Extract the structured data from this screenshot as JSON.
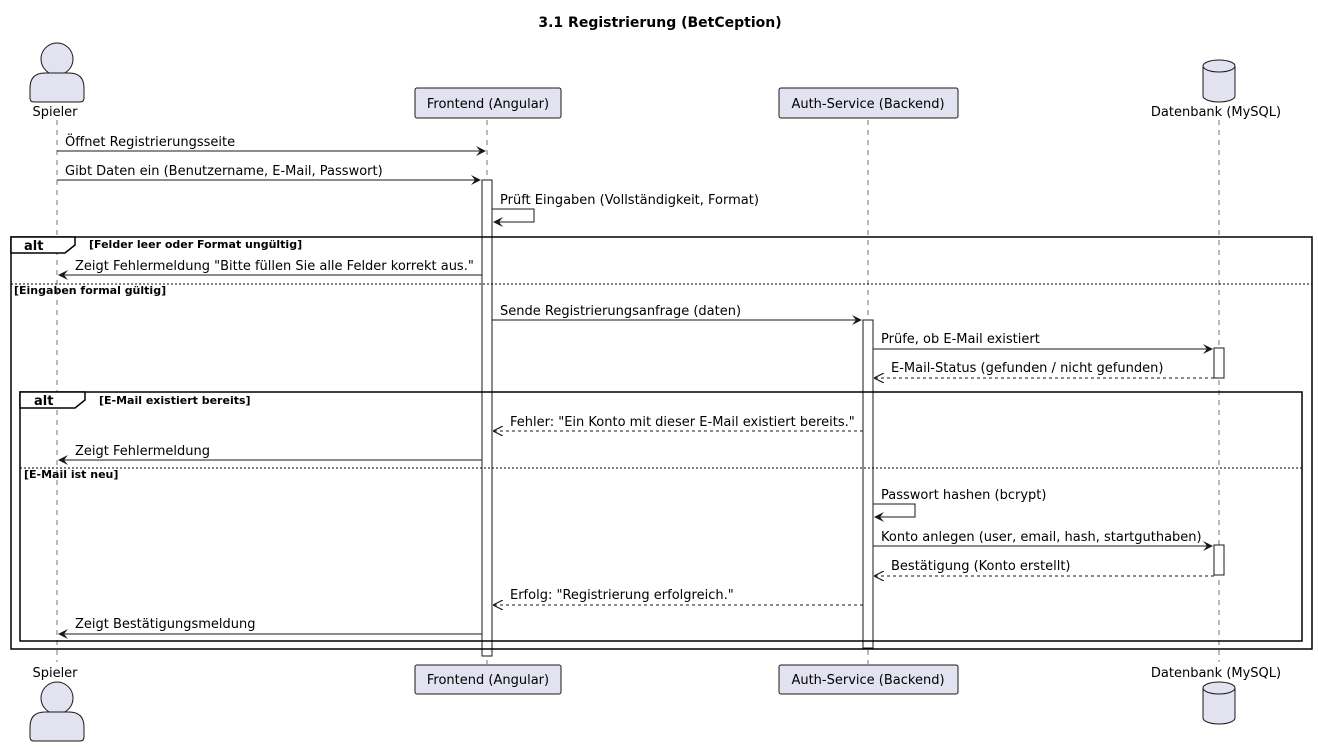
{
  "title": "3.1 Registrierung (BetCeption)",
  "colors": {
    "participant_fill": "#E2E2F0",
    "participant_stroke": "#181818",
    "line": "#181818",
    "background": "#FFFFFF"
  },
  "participants": {
    "spieler": {
      "label": "Spieler",
      "kind": "actor",
      "icon": "actor-icon"
    },
    "frontend": {
      "label": "Frontend (Angular)",
      "kind": "participant"
    },
    "auth": {
      "label": "Auth-Service (Backend)",
      "kind": "participant"
    },
    "db": {
      "label": "Datenbank (MySQL)",
      "kind": "database",
      "icon": "database-icon"
    }
  },
  "messages": {
    "m1": "Öffnet Registrierungsseite",
    "m2": "Gibt Daten ein (Benutzername, E-Mail, Passwort)",
    "m3": "Prüft Eingaben (Vollständigkeit, Format)",
    "m4": "Zeigt Fehlermeldung \"Bitte füllen Sie alle Felder korrekt aus.\"",
    "m5": "Sende Registrierungsanfrage (daten)",
    "m6": "Prüfe, ob E-Mail existiert",
    "m7": "E-Mail-Status (gefunden / nicht gefunden)",
    "m8": "Fehler: \"Ein Konto mit dieser E-Mail existiert bereits.\"",
    "m9": "Zeigt Fehlermeldung",
    "m10": "Passwort hashen (bcrypt)",
    "m11": "Konto anlegen (user, email, hash, startguthaben)",
    "m12": "Bestätigung (Konto erstellt)",
    "m13": "Erfolg: \"Registrierung erfolgreich.\"",
    "m14": "Zeigt Bestätigungsmeldung"
  },
  "fragments": {
    "outer": {
      "operator": "alt",
      "guard": "[Felder leer oder Format ungültig]",
      "else_guard": "[Eingaben formal gültig]"
    },
    "inner": {
      "operator": "alt",
      "guard": "[E-Mail existiert bereits]",
      "else_guard": "[E-Mail ist neu]"
    }
  }
}
